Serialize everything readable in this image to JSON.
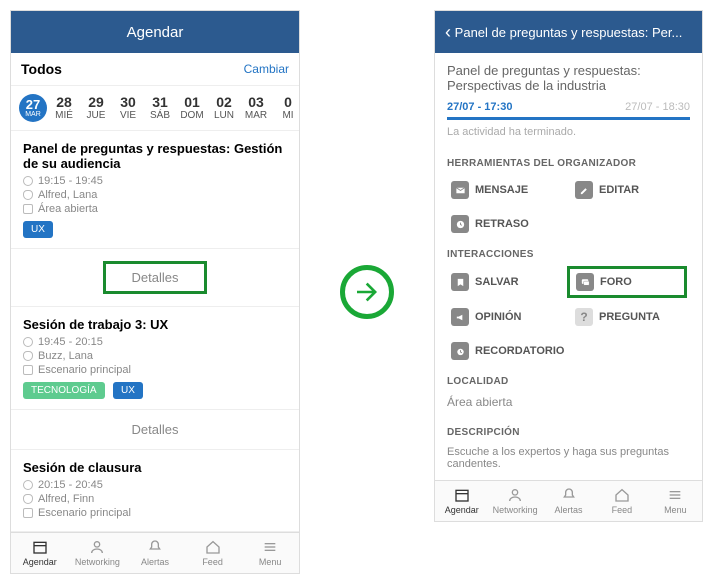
{
  "left": {
    "header_title": "Agendar",
    "filter_label": "Todos",
    "change_label": "Cambiar",
    "dates": [
      {
        "num": "27",
        "lbl": "MAR",
        "sel": true
      },
      {
        "num": "28",
        "lbl": "MIÉ"
      },
      {
        "num": "29",
        "lbl": "JUE"
      },
      {
        "num": "30",
        "lbl": "VIE"
      },
      {
        "num": "31",
        "lbl": "SÁB"
      },
      {
        "num": "01",
        "lbl": "DOM"
      },
      {
        "num": "02",
        "lbl": "LUN"
      },
      {
        "num": "03",
        "lbl": "MAR"
      },
      {
        "num": "0",
        "lbl": "MI"
      }
    ],
    "session1": {
      "title": "Panel de preguntas y respuestas: Gestión de su audiencia",
      "time": "19:15 - 19:45",
      "speaker": "Alfred, Lana",
      "location": "Área abierta",
      "tag_ux": "UX",
      "details": "Detalles"
    },
    "session2": {
      "title": "Sesión de trabajo 3: UX",
      "time": "19:45 - 20:15",
      "speaker": "Buzz, Lana",
      "location": "Escenario principal",
      "tag_tech": "TECNOLOGÍA",
      "tag_ux": "UX",
      "details": "Detalles"
    },
    "session3": {
      "title": "Sesión de clausura",
      "time": "20:15 - 20:45",
      "speaker": "Alfred, Finn",
      "location": "Escenario principal"
    }
  },
  "right": {
    "header_title": "Panel de preguntas y respuestas: Per...",
    "subtitle": "Panel de preguntas y respuestas: Perspectivas de la industria",
    "time_a": "27/07 - 17:30",
    "time_b": "27/07 - 18:30",
    "ended": "La actividad ha terminado.",
    "sect_org": "HERRAMIENTAS DEL ORGANIZADOR",
    "btn_mensaje": "MENSAJE",
    "btn_editar": "EDITAR",
    "btn_retraso": "RETRASO",
    "sect_inter": "INTERACCIONES",
    "btn_salvar": "SALVAR",
    "btn_foro": "FORO",
    "btn_opinion": "OPINIÓN",
    "btn_pregunta": "PREGUNTA",
    "btn_recordatorio": "RECORDATORIO",
    "sect_loc": "LOCALIDAD",
    "loc_val": "Área abierta",
    "sect_desc": "DESCRIPCIÓN",
    "desc_val": "Escuche a los expertos y haga sus preguntas candentes."
  },
  "tabs": {
    "agendar": "Agendar",
    "networking": "Networking",
    "alertas": "Alertas",
    "feed": "Feed",
    "menu": "Menu"
  }
}
